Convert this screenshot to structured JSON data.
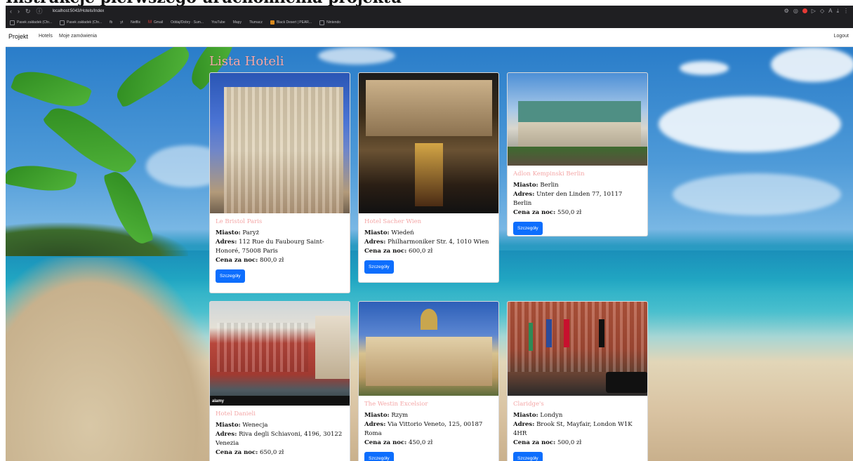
{
  "heading_banner": "Instrukcje pierwszego uruchomienia projektu",
  "browser": {
    "url": "localhost:5043/Hotels/Index",
    "bookmarks": [
      {
        "label": "Pasek zakładek (Chr..."
      },
      {
        "label": "Pasek zakładek (Chr..."
      },
      {
        "label": "fb"
      },
      {
        "label": "yt"
      },
      {
        "label": "Netflix"
      },
      {
        "label": "Gmail"
      },
      {
        "label": "Oddaj/Dobry · Sum..."
      },
      {
        "label": "YouTube"
      },
      {
        "label": "Mapy"
      },
      {
        "label": "Tłumacz"
      },
      {
        "label": "Black Desert | PEAR..."
      },
      {
        "label": "Nintendo"
      }
    ]
  },
  "navbar": {
    "brand": "Projekt",
    "links": [
      "Hotels",
      "Moje zamówienia"
    ],
    "logout": "Logout"
  },
  "page": {
    "title": "Lista Hoteli"
  },
  "labels": {
    "city": "Miasto:",
    "address": "Adres:",
    "price": "Cena za noc:",
    "details_btn": "Szczegóły"
  },
  "hotels": [
    {
      "name": "Le Bristol Paris",
      "city": "Paryż",
      "address": "112 Rue du Faubourg Saint-Honoré, 75008 Paris",
      "price": "800,0 zł"
    },
    {
      "name": "Hotel Sacher Wien",
      "city": "Wiedeń",
      "address": "Philharmoniker Str. 4, 1010 Wien",
      "price": "600,0 zł"
    },
    {
      "name": "Adlon Kempinski Berlin",
      "city": "Berlin",
      "address": "Unter den Linden 77, 10117 Berlin",
      "price": "550,0 zł"
    },
    {
      "name": "Hotel Danieli",
      "city": "Wenecja",
      "address": "Riva degli Schiavoni, 4196, 30122 Venezia",
      "price": "650,0 zł",
      "photo_label": "alamy"
    },
    {
      "name": "The Westin Excelsior",
      "city": "Rzym",
      "address": "Via Vittorio Veneto, 125, 00187 Roma",
      "price": "450,0 zł"
    },
    {
      "name": "Claridge's",
      "city": "Londyn",
      "address": "Brook St, Mayfair, London W1K 4HR",
      "price": "500,0 zł"
    }
  ],
  "colors": {
    "accent": "#0d6efd",
    "title_pink": "#f4a6a6",
    "browser_dark": "#1f1f22"
  }
}
